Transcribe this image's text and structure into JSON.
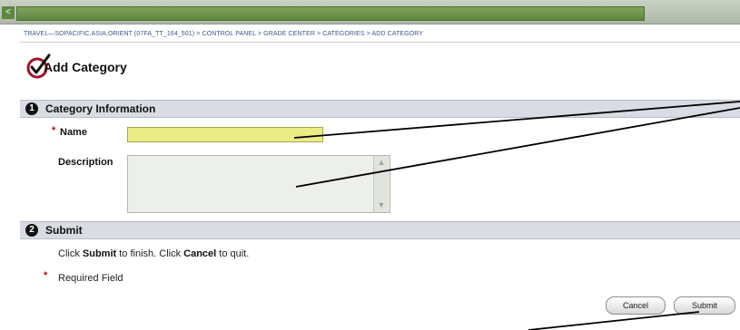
{
  "window": {
    "scroll_left_glyph": "<"
  },
  "breadcrumb": "TRAVEL—SOPACIFIC,ASIA,ORIENT (07FA_TT_164_501) > CONTROL PANEL > GRADE CENTER > CATEGORIES > ADD CATEGORY",
  "page": {
    "title": "Add Category"
  },
  "sections": [
    {
      "step": "1",
      "title": "Category Information"
    },
    {
      "step": "2",
      "title": "Submit"
    }
  ],
  "form": {
    "name_label": "Name",
    "name_value": "",
    "description_label": "Description",
    "description_value": "",
    "required_marker": "*"
  },
  "submit_section": {
    "instruction_pre": "Click ",
    "submit_word": "Submit",
    "instruction_mid": " to finish. Click ",
    "cancel_word": "Cancel",
    "instruction_post": " to quit.",
    "required_note": "Required Field"
  },
  "buttons": {
    "cancel": "Cancel",
    "submit": "Submit"
  },
  "colors": {
    "name_field_bg": "#ecec84",
    "section_header_bg": "#d9dce2",
    "required_marker": "#cc0000"
  }
}
